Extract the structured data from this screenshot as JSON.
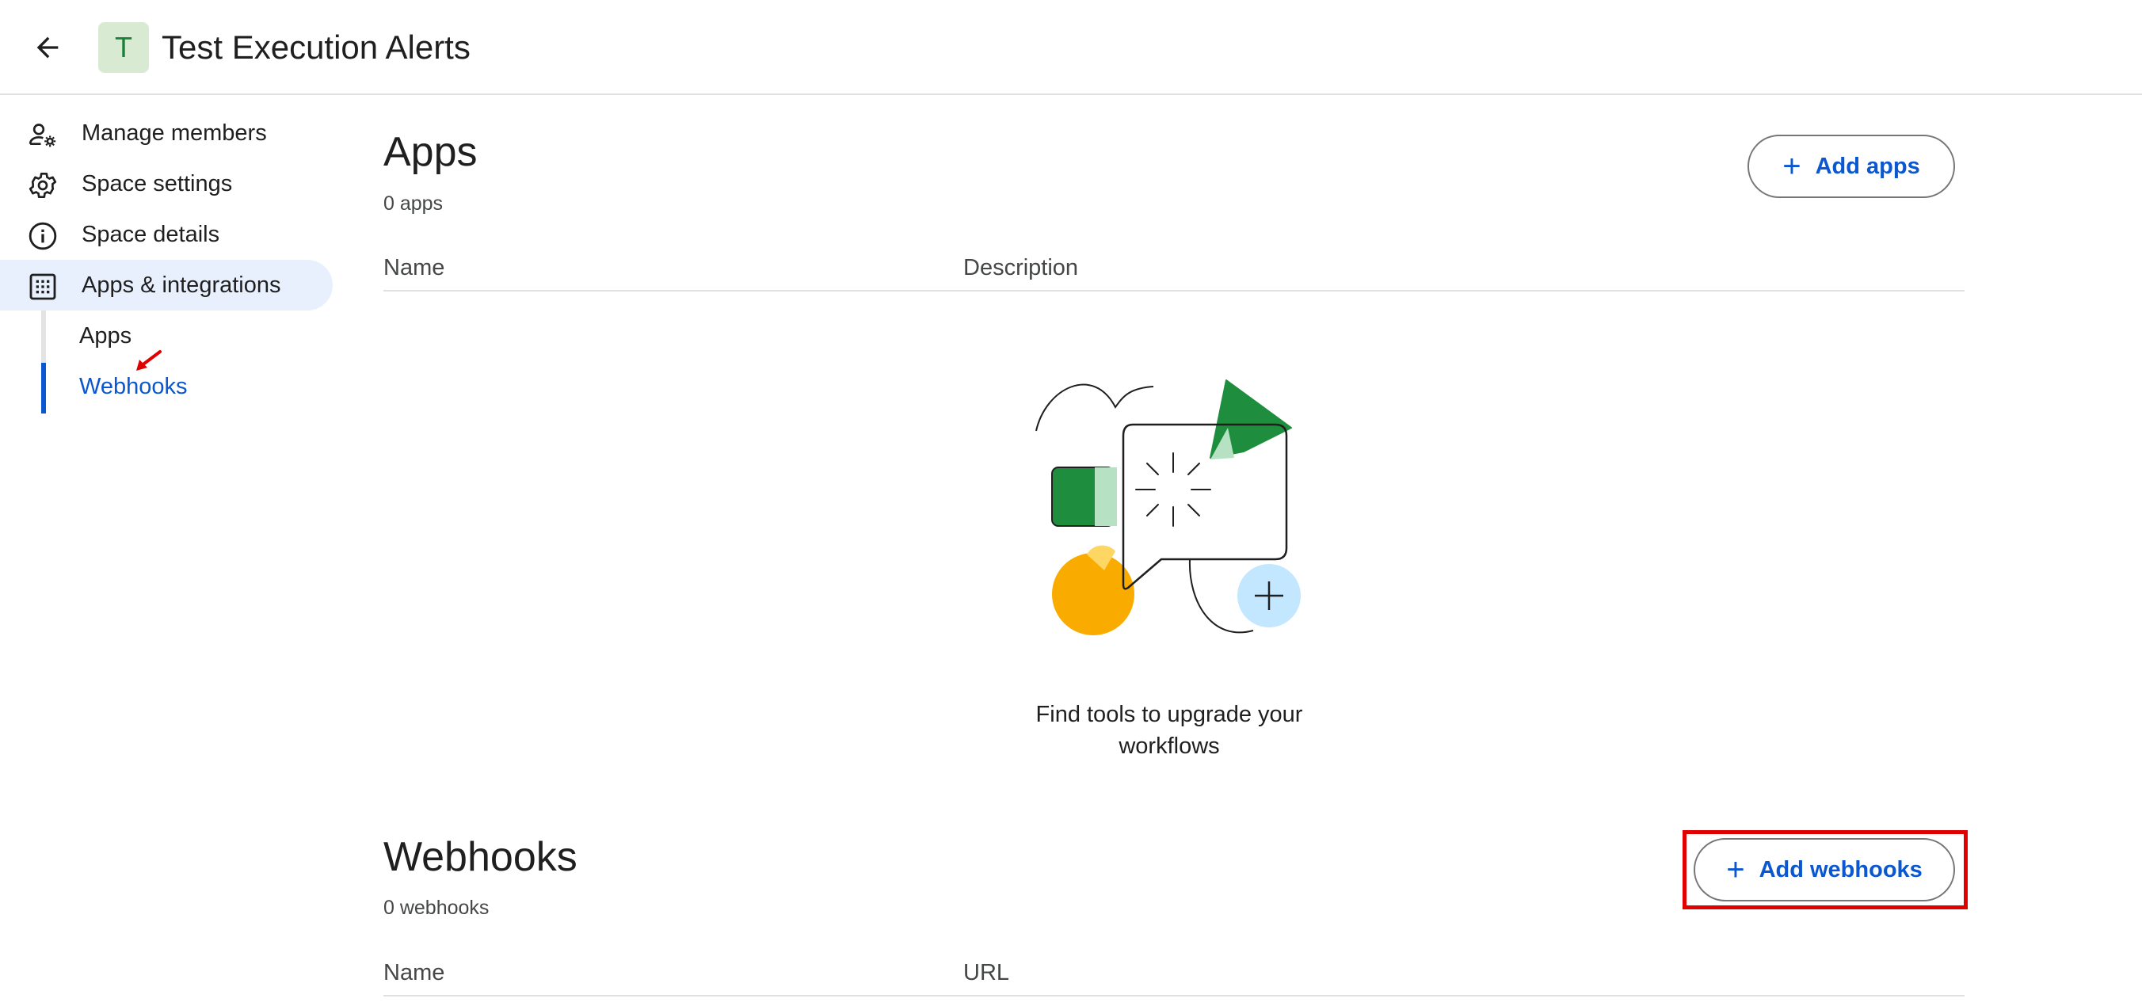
{
  "header": {
    "title": "Test Execution Alerts",
    "avatar_letter": "T"
  },
  "sidebar": {
    "items": [
      {
        "label": "Manage members",
        "icon": "manage-members-icon"
      },
      {
        "label": "Space settings",
        "icon": "gear-icon"
      },
      {
        "label": "Space details",
        "icon": "info-icon"
      },
      {
        "label": "Apps & integrations",
        "icon": "apps-grid-icon",
        "active": true
      }
    ],
    "subitems": [
      {
        "label": "Apps"
      },
      {
        "label": "Webhooks",
        "active": true
      }
    ]
  },
  "apps_section": {
    "title": "Apps",
    "count": "0 apps",
    "add_label": "Add apps",
    "columns": [
      "Name",
      "Description"
    ],
    "empty_text": "Find tools to upgrade your workflows"
  },
  "webhooks_section": {
    "title": "Webhooks",
    "count": "0 webhooks",
    "add_label": "Add webhooks",
    "columns": [
      "Name",
      "URL"
    ]
  },
  "colors": {
    "accent": "#0b57d0",
    "active_nav_bg": "#e8f0fe",
    "highlight_border": "#e00000",
    "illustration_green": "#1e8e3e",
    "illustration_yellow": "#f9ab00",
    "illustration_blue": "#c2e7ff"
  }
}
